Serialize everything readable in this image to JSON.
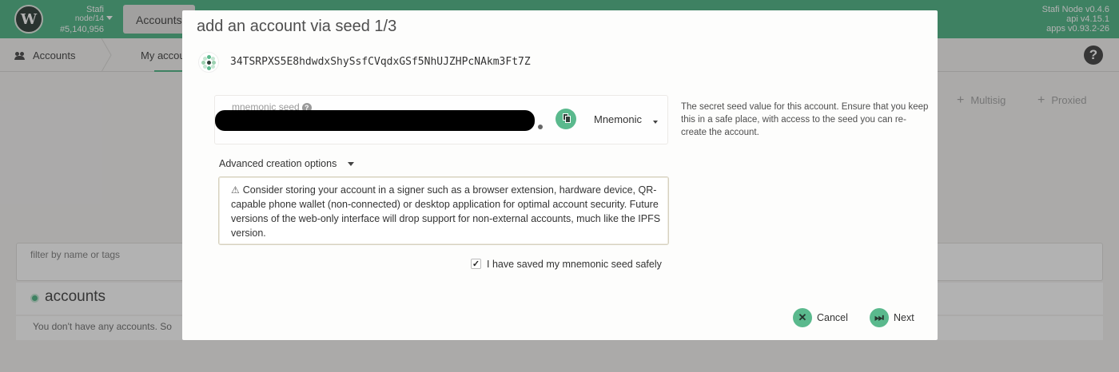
{
  "topbar": {
    "logo_letter": "W",
    "chain_name": "Stafi",
    "node_label": "node/14",
    "block_number": "#5,140,956",
    "active_tab": "Accounts",
    "node_version": "Stafi Node v0.4.6",
    "api_version": "api v4.15.1",
    "apps_version": "apps v0.93.2-26",
    "brand_color": "#5ab98d"
  },
  "subnav": {
    "section_label": "Accounts",
    "active_tab": "My accou",
    "help_icon": "?"
  },
  "page": {
    "actions": [
      "Multisig",
      "Proxied"
    ],
    "filter_label": "filter by name or tags",
    "accounts_heading": "accounts",
    "empty_text": "You don't have any accounts. So"
  },
  "modal": {
    "title": "add an account via seed 1/3",
    "address": "34TSRPXS5E8hdwdxShySsfCVqdxGSf5NhUJZHPcNAkm3Ft7Z",
    "seed_label": "mnemonic seed",
    "seed_help_icon": "?",
    "seed_type": "Mnemonic",
    "seed_help_text": "The secret seed value for this account. Ensure that you keep this in a safe place, with access to the seed you can re-create the account.",
    "advanced_label": "Advanced creation options",
    "warning_icon": "⚠",
    "warning_text": "Consider storing your account in a signer such as a browser extension, hardware device, QR-capable phone wallet (non-connected) or desktop application for optimal account security. Future versions of the web-only interface will drop support for non-external accounts, much like the IPFS version.",
    "checkbox_mark": "✓",
    "confirm_label": "I have saved my mnemonic seed safely",
    "cancel_icon": "✕",
    "cancel_label": "Cancel",
    "next_icon": "⏭",
    "next_label": "Next"
  }
}
